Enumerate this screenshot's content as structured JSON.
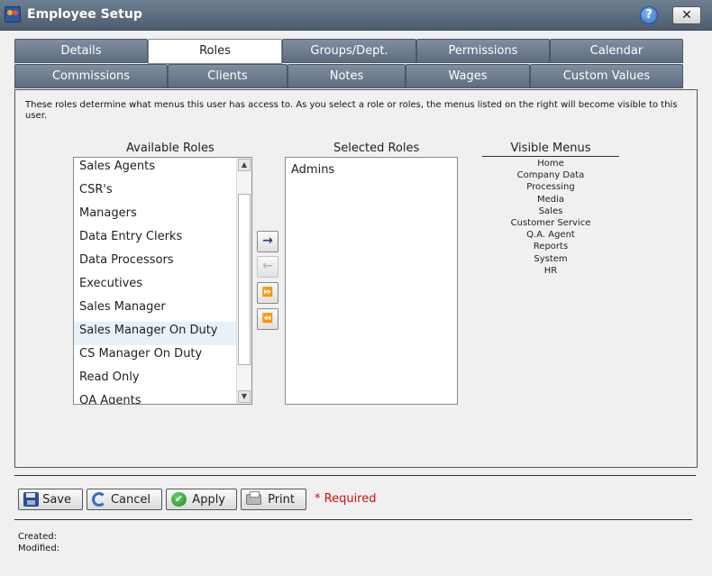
{
  "window": {
    "title": "Employee Setup",
    "help_icon": "?",
    "close_icon": "✕"
  },
  "tabs": {
    "row1": [
      "Details",
      "Roles",
      "Groups/Dept.",
      "Permissions",
      "Calendar"
    ],
    "row2": [
      "Commissions",
      "Clients",
      "Notes",
      "Wages",
      "Custom Values"
    ],
    "active": "Roles"
  },
  "roles_panel": {
    "description": "These roles determine what menus this user has access to. As you select a role or roles, the menus listed on the right will become visible to this user.",
    "available_label": "Available Roles",
    "selected_label": "Selected Roles",
    "visible_menus_label": "Visible Menus",
    "available_roles": [
      "Sales Agents",
      "CSR's",
      "Managers",
      "Data Entry Clerks",
      "Data Processors",
      "Executives",
      "Sales Manager",
      "Sales Manager On Duty",
      "CS Manager On Duty",
      "Read Only",
      "QA Agents"
    ],
    "hovered_role": "Sales Manager On Duty",
    "selected_roles": [
      "Admins"
    ],
    "visible_menus": [
      "Home",
      "Company Data",
      "Processing",
      "Media",
      "Sales",
      "Customer Service",
      "Q.A. Agent",
      "Reports",
      "System",
      "HR"
    ],
    "move_buttons": {
      "add": "→",
      "remove": "←",
      "add_all": "⏩",
      "remove_all": "⏪"
    },
    "scroll_up_icon": "▲",
    "scroll_down_icon": "▼"
  },
  "actions": {
    "save": "Save",
    "cancel": "Cancel",
    "apply": "Apply",
    "apply_icon": "✔",
    "print": "Print",
    "required_note": "* Required"
  },
  "footer": {
    "created_label": "Created:",
    "modified_label": "Modified:"
  },
  "colors": {
    "titlebar": "#5a6a7e",
    "tab_inactive": "#6f7d90",
    "required_text": "#d01010"
  }
}
